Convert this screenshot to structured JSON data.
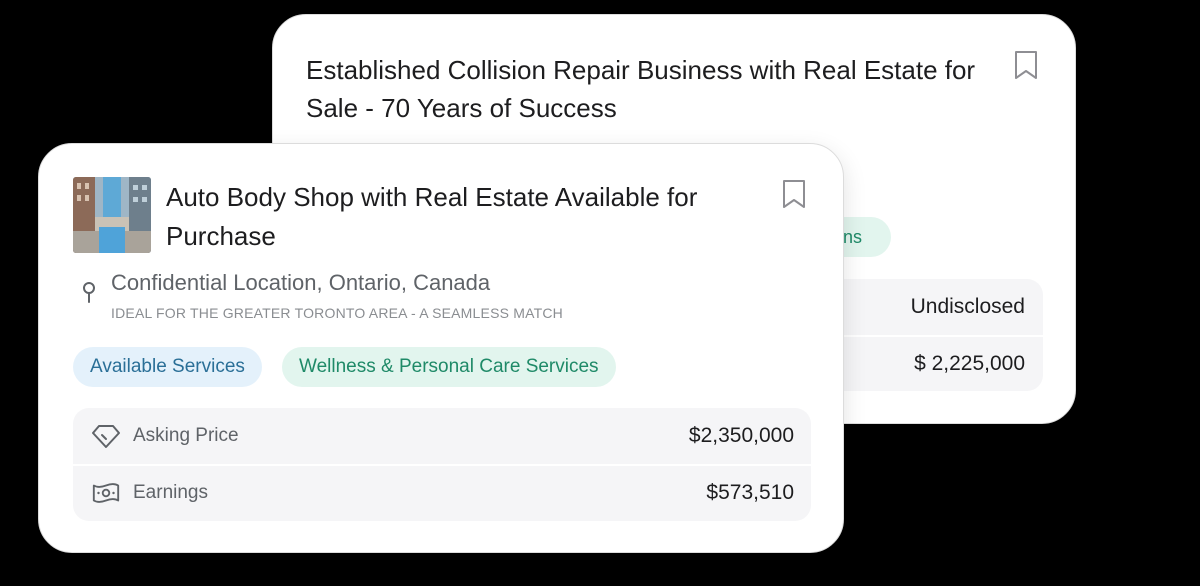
{
  "back_card": {
    "title": "Established Collision Repair Business with Real Estate for Sale - 70 Years of Success",
    "tag_partial": "ons",
    "stats": [
      {
        "value": "Undisclosed"
      },
      {
        "value": "$ 2,225,000"
      }
    ]
  },
  "front_card": {
    "title": "Auto Body Shop with Real Estate Available for Purchase",
    "location": "Confidential Location, Ontario, Canada",
    "subline": "IDEAL FOR THE GREATER TORONTO AREA - A SEAMLESS MATCH",
    "tags": [
      {
        "label": "Available Services"
      },
      {
        "label": "Wellness & Personal Care Services"
      }
    ],
    "stats": [
      {
        "icon": "diamond-icon",
        "label": "Asking Price",
        "value": "$2,350,000"
      },
      {
        "icon": "cash-icon",
        "label": "Earnings",
        "value": "$573,510"
      }
    ]
  },
  "colors": {
    "tag_blue_bg": "#e4f1fb",
    "tag_blue_text": "#2a6f97",
    "tag_green_bg": "#e2f5ee",
    "tag_green_text": "#1f8a68"
  }
}
